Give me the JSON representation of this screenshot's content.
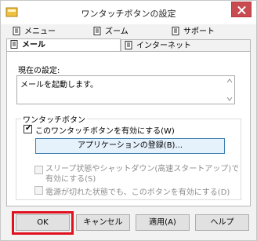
{
  "window": {
    "title": "ワンタッチボタンの設定"
  },
  "tabs": [
    {
      "label": "メニュー",
      "icon": "document-icon"
    },
    {
      "label": "ズーム",
      "icon": "document-icon"
    },
    {
      "label": "サポート",
      "icon": "document-icon"
    },
    {
      "label": "メール",
      "icon": "document-icon"
    },
    {
      "label": "インターネット",
      "icon": "document-icon"
    }
  ],
  "current_setting": {
    "label": "現在の設定:",
    "value": "メールを起動します。"
  },
  "onetouch_group": {
    "title": "ワンタッチボタン",
    "enable_label": "このワンタッチボタンを有効にする(W)",
    "register_button": "アプリケーションの登録(B)...",
    "sleep_label_line1": "スリープ状態やシャットダウン(高速スタートアップ)でも、このボタンを",
    "sleep_label_line2": "有効にする(S)",
    "power_off_label": "電源が切れた状態でも、このボタンを有効にする(D)"
  },
  "buttons": {
    "ok": "OK",
    "cancel": "キャンセル",
    "apply": "適用(A)",
    "help": "ヘルプ"
  },
  "colors": {
    "highlight": "#e0101e",
    "close": "#c74b50"
  }
}
